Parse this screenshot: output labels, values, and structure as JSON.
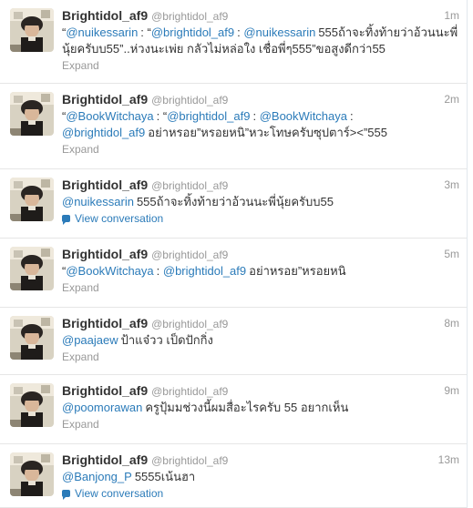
{
  "tweets": [
    {
      "fullname": "Brightidol_af9",
      "username": "@brightidol_af9",
      "time": "1m",
      "parts": [
        {
          "t": "“",
          "c": "text"
        },
        {
          "t": "@nuikessarin",
          "c": "mention"
        },
        {
          "t": ": “",
          "c": "text"
        },
        {
          "t": "@brightidol_af9",
          "c": "mention"
        },
        {
          "t": ": ",
          "c": "text"
        },
        {
          "t": "@nuikessarin",
          "c": "mention"
        },
        {
          "t": "555ถ้าจะทิ้งท้ายว่าอ้วนนะพี่นุ้ยครับบ55”..ห่วงนะเพ่ย กลัวไม่หล่อใง เชื่อพี่ๆ555”ขอสูงดีกว่า55",
          "c": "text"
        }
      ],
      "action": "Expand",
      "action_type": "expand"
    },
    {
      "fullname": "Brightidol_af9",
      "username": "@brightidol_af9",
      "time": "2m",
      "parts": [
        {
          "t": "“",
          "c": "text"
        },
        {
          "t": "@BookWitchaya",
          "c": "mention"
        },
        {
          "t": ": “",
          "c": "text"
        },
        {
          "t": "@brightidol_af9",
          "c": "mention"
        },
        {
          "t": ": ",
          "c": "text"
        },
        {
          "t": "@BookWitchaya",
          "c": "mention"
        },
        {
          "t": ": ",
          "c": "text"
        },
        {
          "t": "@brightidol_af9",
          "c": "mention"
        },
        {
          "t": "อย่าหรอย”หรอยหนิ”หวะโทษครับซุปตาร์><”555",
          "c": "text"
        }
      ],
      "action": "Expand",
      "action_type": "expand"
    },
    {
      "fullname": "Brightidol_af9",
      "username": "@brightidol_af9",
      "time": "3m",
      "parts": [
        {
          "t": "@nuikessarin",
          "c": "mention"
        },
        {
          "t": "555ถ้าจะทิ้งท้ายว่าอ้วนนะพี่นุ้ยครับบ55",
          "c": "text"
        }
      ],
      "action": "View conversation",
      "action_type": "conversation"
    },
    {
      "fullname": "Brightidol_af9",
      "username": "@brightidol_af9",
      "time": "5m",
      "parts": [
        {
          "t": "“",
          "c": "text"
        },
        {
          "t": "@BookWitchaya",
          "c": "mention"
        },
        {
          "t": ": ",
          "c": "text"
        },
        {
          "t": "@brightidol_af9",
          "c": "mention"
        },
        {
          "t": "อย่าหรอย”หรอยหนิ",
          "c": "text"
        }
      ],
      "action": "Expand",
      "action_type": "expand"
    },
    {
      "fullname": "Brightidol_af9",
      "username": "@brightidol_af9",
      "time": "8m",
      "parts": [
        {
          "t": "@paajaew",
          "c": "mention"
        },
        {
          "t": "ป้าแจ๋วว เป็ดปักกิ่ง",
          "c": "text"
        }
      ],
      "action": "Expand",
      "action_type": "expand"
    },
    {
      "fullname": "Brightidol_af9",
      "username": "@brightidol_af9",
      "time": "9m",
      "parts": [
        {
          "t": "@poomorawan",
          "c": "mention"
        },
        {
          "t": "ครูปุ้มมช่วงนี้ผมสื่อะไรครับ 55 อยากเห็น",
          "c": "text"
        }
      ],
      "action": "Expand",
      "action_type": "expand"
    },
    {
      "fullname": "Brightidol_af9",
      "username": "@brightidol_af9",
      "time": "13m",
      "parts": [
        {
          "t": "@Banjong_P",
          "c": "mention"
        },
        {
          "t": "5555เน้นฮา",
          "c": "text"
        }
      ],
      "action": "View conversation",
      "action_type": "conversation"
    }
  ]
}
